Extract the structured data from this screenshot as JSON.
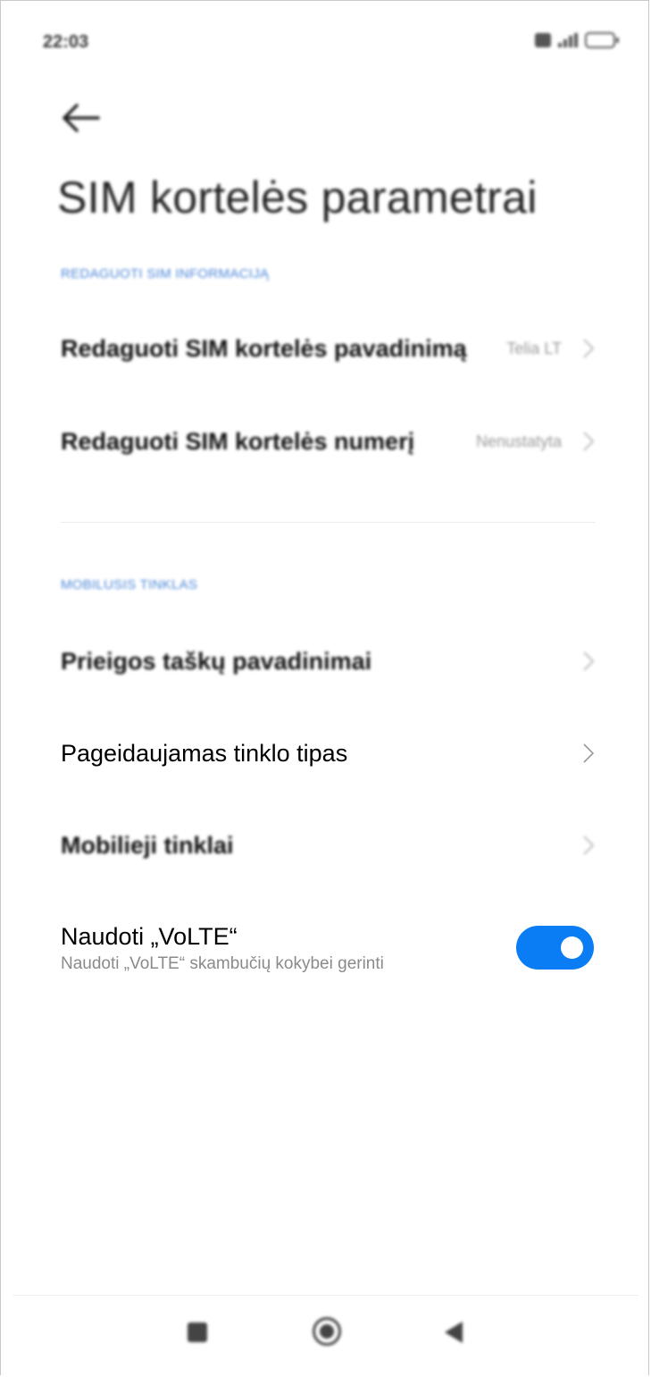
{
  "status_bar": {
    "time": "22:03",
    "icons": [
      "sim-icon",
      "signal-icon",
      "battery-icon"
    ],
    "battery_level": "55"
  },
  "header": {
    "back_icon": "arrow-left-icon",
    "title": "SIM kortelės parametrai"
  },
  "sections": {
    "sim_info": {
      "heading": "REDAGUOTI SIM INFORMACIJĄ",
      "items": [
        {
          "label": "Redaguoti SIM kortelės pavadinimą",
          "value": "Telia LT"
        },
        {
          "label": "Redaguoti SIM kortelės numerį",
          "value": "Nenustatyta"
        }
      ]
    },
    "mobile_network": {
      "heading": "MOBILUSIS TINKLAS",
      "items": [
        {
          "label": "Prieigos taškų pavadinimai"
        },
        {
          "label": "Pageidaujamas tinklo tipas"
        },
        {
          "label": "Mobilieji tinklai"
        }
      ],
      "volte": {
        "title": "Naudoti „VoLTE“",
        "subtitle": "Naudoti „VoLTE“ skambučių kokybei gerinti",
        "enabled": true
      }
    }
  },
  "nav_bar": {
    "icons": [
      "recents-square-icon",
      "home-circle-icon",
      "back-triangle-icon"
    ]
  },
  "colors": {
    "accent": "#0a7df4",
    "section_heading": "#4a86d8"
  }
}
